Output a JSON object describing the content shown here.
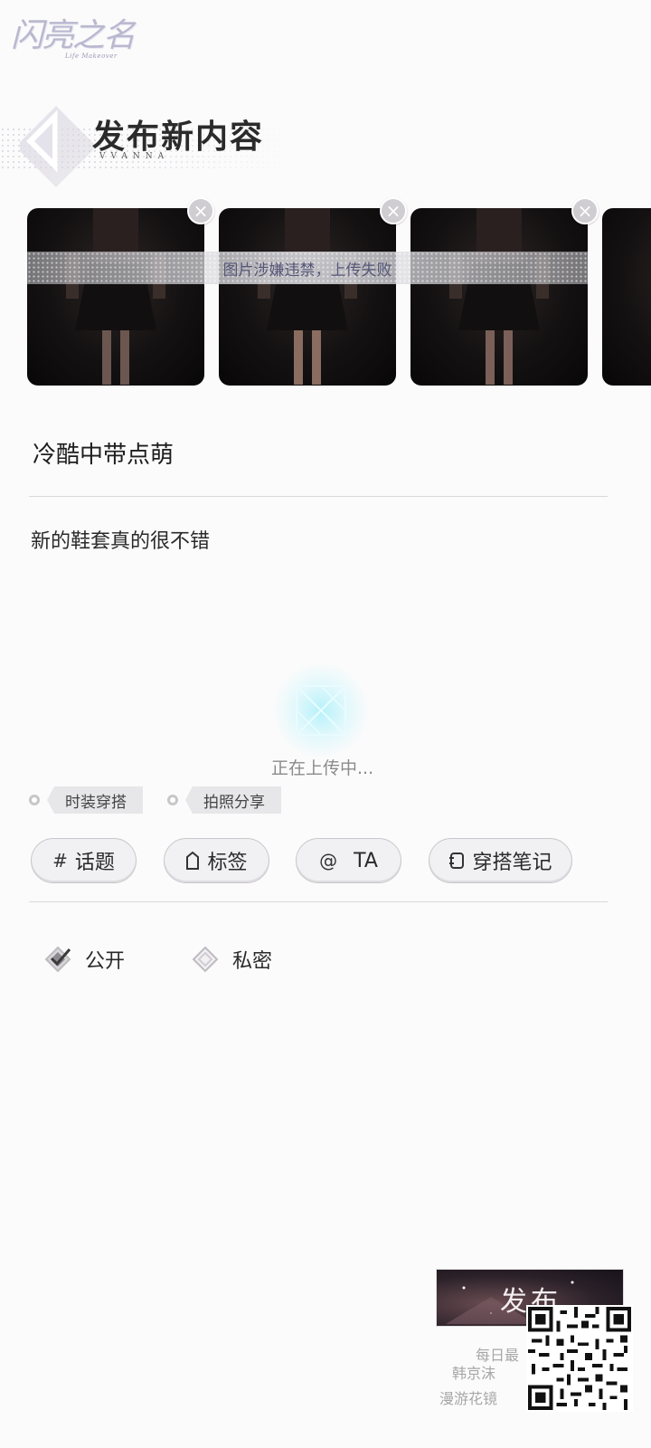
{
  "logo": {
    "main": "闪亮之名",
    "sub": "Life Makeover"
  },
  "header": {
    "title": "发布新内容",
    "subtitle": "VVANNA"
  },
  "images": {
    "error_banner": "图片涉嫌违禁，上传失败",
    "remove_symbol": "×"
  },
  "post": {
    "title": "冷酷中带点萌",
    "body": "新的鞋套真的很不错"
  },
  "upload": {
    "status": "正在上传中..."
  },
  "chips": [
    "时装穿搭",
    "拍照分享"
  ],
  "actions": {
    "topic": {
      "icon": "#",
      "label": "话题"
    },
    "tag": {
      "label": "标签"
    },
    "mention": {
      "icon": "@",
      "label": "TA"
    },
    "outfit": {
      "label": "穿搭笔记"
    }
  },
  "privacy": {
    "public_label": "公开",
    "private_label": "私密",
    "selected": "public"
  },
  "promo": {
    "banner": "发布",
    "line1": "每日最",
    "line2": "韩京沫",
    "line3": "漫游花镜"
  },
  "colors": {
    "background": "#fcfbfb",
    "chip": "#e7e6e8",
    "button_border": "#c9c7cb",
    "error_text": "#565678",
    "glow": "#aaf0fa"
  }
}
